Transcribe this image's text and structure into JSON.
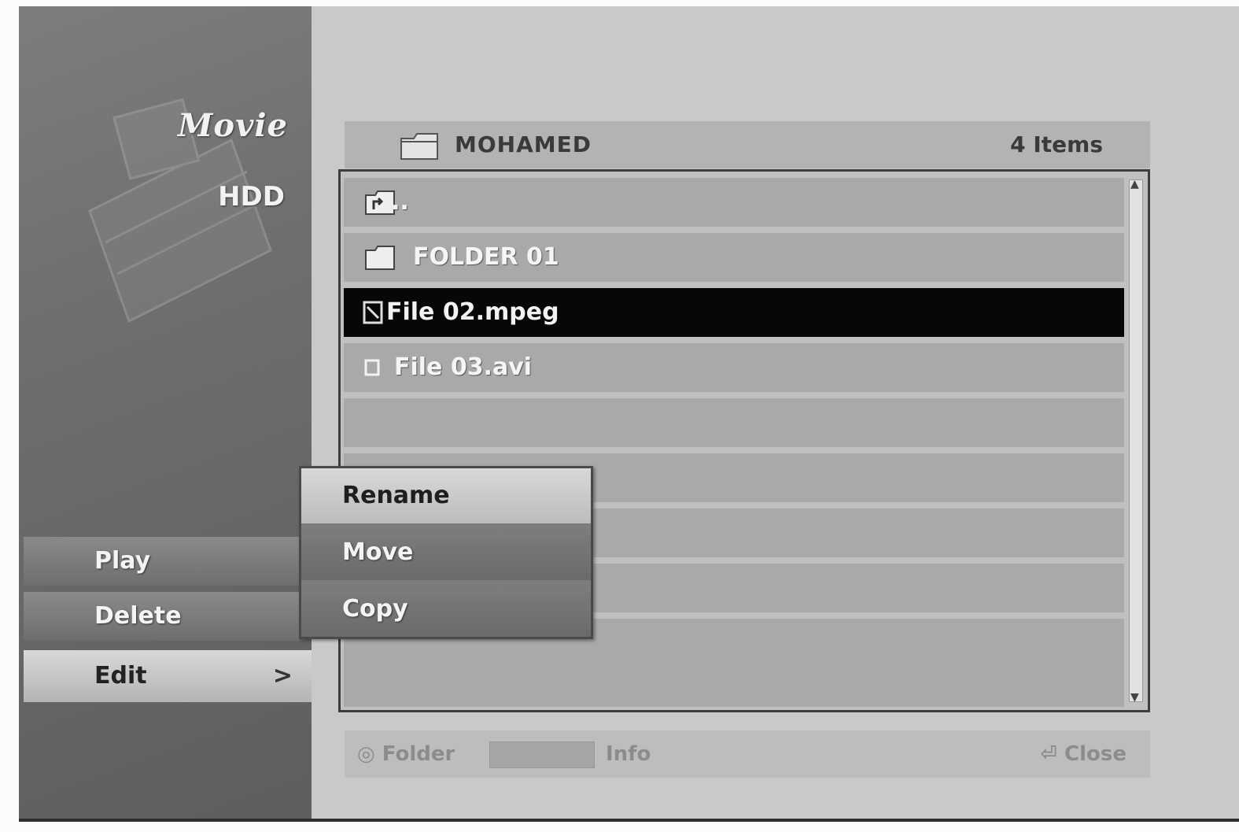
{
  "panel": {
    "title": "Movie",
    "subtitle": "HDD"
  },
  "left_menu": {
    "play": "Play",
    "delete": "Delete",
    "edit": "Edit",
    "edit_arrow": ">"
  },
  "header": {
    "folder_name": "MOHAMED",
    "item_count": "4 Items"
  },
  "files": [
    {
      "label": "..",
      "icon": "parent-folder-icon",
      "selected": false
    },
    {
      "label": "FOLDER 01",
      "icon": "folder-icon",
      "selected": false
    },
    {
      "label": "File 02.mpeg",
      "icon": "movie-file-icon",
      "selected": true
    },
    {
      "label": "File 03.avi",
      "icon": "movie-file-icon",
      "selected": false
    }
  ],
  "footer": {
    "folder_hint": "Folder",
    "info_hint": "Info",
    "close_hint": "Close"
  },
  "submenu": {
    "rename": "Rename",
    "move": "Move",
    "copy": "Copy"
  },
  "colors": {
    "selected_row": "#070707",
    "row": "#a9a9a9",
    "panel": "#6f6f6f"
  }
}
